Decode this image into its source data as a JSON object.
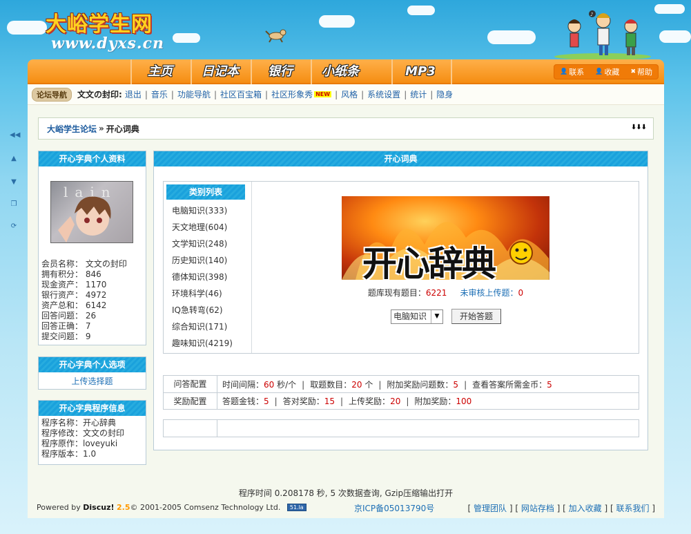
{
  "site": {
    "logo_text": "大峪学生网",
    "logo_url": "www.dyxs.cn"
  },
  "nav": {
    "items": [
      "主页",
      "日记本",
      "银行",
      "小纸条",
      "MP3"
    ],
    "right": [
      {
        "label": "联系",
        "icon": "person-icon"
      },
      {
        "label": "收藏",
        "icon": "person-icon"
      },
      {
        "label": "帮助",
        "icon": "close-icon"
      }
    ]
  },
  "forum_nav": {
    "badge": "论坛导航",
    "user": "文文の封印:",
    "links": [
      "退出",
      "音乐",
      "功能导航",
      "社区百宝箱",
      "社区形象秀",
      "风格",
      "系统设置",
      "统计",
      "隐身"
    ],
    "new_badge": "NEW"
  },
  "breadcrumb": {
    "home": "大峪学生论坛",
    "separator": "»",
    "current": "开心词典",
    "arrows": "⬇⬇⬇"
  },
  "profile": {
    "title": "开心字典个人资料",
    "avatar_text": "lain",
    "rows": [
      {
        "label": "会员名称：",
        "value": "文文の封印"
      },
      {
        "label": "拥有积分：",
        "value": "846"
      },
      {
        "label": "现金资产：",
        "value": "1170"
      },
      {
        "label": "银行资产：",
        "value": "4972"
      },
      {
        "label": "资产总和：",
        "value": "6142"
      },
      {
        "label": "回答问题：",
        "value": "26"
      },
      {
        "label": "回答正确：",
        "value": "7"
      },
      {
        "label": "提交问题：",
        "value": "9"
      }
    ]
  },
  "options": {
    "title": "开心字典个人选项",
    "upload": "上传选择题"
  },
  "program": {
    "title": "开心字典程序信息",
    "rows": [
      "程序名称：开心辞典",
      "程序修改：文文の封印",
      "程序原作：loveyuki",
      "程序版本：1.0"
    ]
  },
  "main": {
    "title": "开心词典",
    "category_head": "类别列表",
    "categories": [
      "电脑知识(333)",
      "天文地理(604)",
      "文学知识(248)",
      "历史知识(140)",
      "德体知识(398)",
      "环境科学(46)",
      "IQ急转弯(62)",
      "综合知识(171)",
      "趣味知识(4219)"
    ],
    "banner_text": "开心辞典",
    "stats": {
      "total_label": "题库现有题目：",
      "total": "6221",
      "pending_label": "未审核上传题：",
      "pending": "0"
    },
    "select_value": "电脑知识",
    "start_button": "开始答题"
  },
  "config": {
    "answer": {
      "label": "问答配置",
      "parts": [
        {
          "text": "时间间隔：",
          "value": "60",
          "suffix": "秒/个"
        },
        {
          "text": "取题数目：",
          "value": "20",
          "suffix": "个"
        },
        {
          "text": "附加奖励问题数：",
          "value": "5",
          "suffix": ""
        },
        {
          "text": "查看答案所需金币：",
          "value": "5",
          "suffix": ""
        }
      ]
    },
    "reward": {
      "label": "奖励配置",
      "parts": [
        {
          "text": "答题金钱：",
          "value": "5"
        },
        {
          "text": "答对奖励：",
          "value": "15"
        },
        {
          "text": "上传奖励：",
          "value": "20"
        },
        {
          "text": "附加奖励：",
          "value": "100"
        }
      ]
    }
  },
  "footer": {
    "time": "程序时间 0.208178 秒, 5 次数据查询, Gzip压缩输出打开",
    "powered": "Powered by",
    "discuz": "Discuz!",
    "version": "2.5",
    "copyright": "© 2001-2005 Comsenz Technology Ltd.",
    "badge": "51.la",
    "icp": "京ICP备05013790号",
    "links": [
      "管理团队",
      "网站存档",
      "加入收藏",
      "联系我们"
    ]
  }
}
